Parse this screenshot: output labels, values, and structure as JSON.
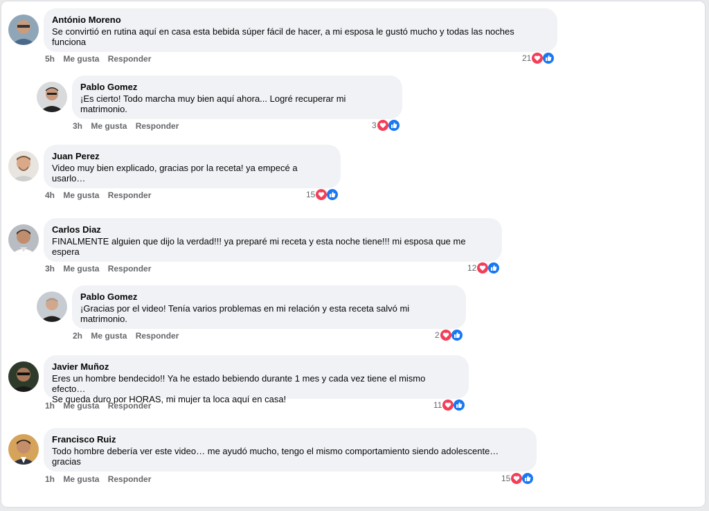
{
  "colors": {
    "like": "#1877f2",
    "love": "#f33e58",
    "bubble": "#f0f2f5",
    "meta": "#65676b"
  },
  "actions": {
    "like_label": "Me gusta",
    "reply_label": "Responder"
  },
  "comments": [
    {
      "author": "António Moreno",
      "text": "Se convirtió en rutina aquí en casa esta bebida súper fácil de hacer, a mi esposa le gustó mucho y todas las noches funciona",
      "time": "5h",
      "reactions": "21",
      "avatar_icon": "user-avatar"
    },
    {
      "author": "Pablo Gomez",
      "text": "¡Es cierto! Todo marcha muy bien aquí ahora... Logré recuperar mi matrimonio.",
      "time": "3h",
      "reactions": "3",
      "avatar_icon": "user-avatar"
    },
    {
      "author": "Juan Perez",
      "text": "Video muy bien explicado, gracias por la receta! ya empecé a usarlo…",
      "time": "4h",
      "reactions": "15",
      "avatar_icon": "user-avatar"
    },
    {
      "author": "Carlos Diaz",
      "text": "FINALMENTE alguien que dijo la verdad!!! ya preparé mi receta y esta noche tiene!!! mi esposa que me espera",
      "time": "3h",
      "reactions": "12",
      "avatar_icon": "user-avatar"
    },
    {
      "author": "Pablo Gomez",
      "text": "¡Gracias por el video! Tenía varios problemas en mi relación y esta receta salvó mi matrimonio.",
      "time": "2h",
      "reactions": "2",
      "avatar_icon": "user-avatar"
    },
    {
      "author": "Javier Muñoz",
      "text": "Eres un hombre bendecido!! Ya he estado bebiendo durante 1 mes y cada vez tiene el mismo efecto…\nSe queda duro por HORAS, mi mujer ta loca aquí en casa!",
      "time": "1h",
      "reactions": "11",
      "avatar_icon": "user-avatar"
    },
    {
      "author": "Francisco Ruiz",
      "text": "Todo hombre debería ver este video… me ayudó mucho, tengo el mismo comportamiento siendo adolescente… gracias",
      "time": "1h",
      "reactions": "15",
      "avatar_icon": "user-avatar"
    }
  ]
}
